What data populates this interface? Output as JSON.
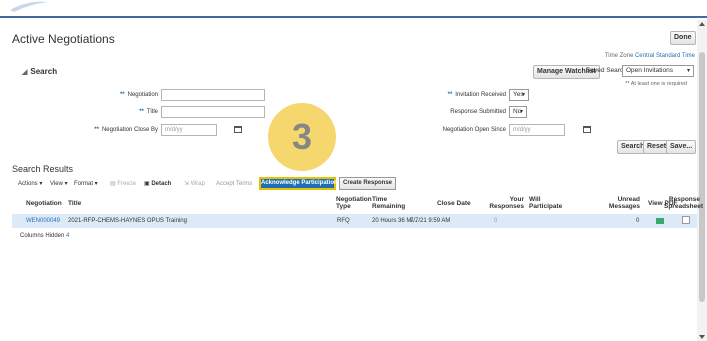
{
  "page": {
    "title": "Active Negotiations",
    "done_label": "Done",
    "time_zone_label": "Time Zone",
    "time_zone_value": "Central Standard Time"
  },
  "search": {
    "heading": "Search",
    "manage_watchlist_label": "Manage Watchlist",
    "saved_search_label": "Saved Search",
    "saved_search_value": "Open Invitations",
    "required_note": "** At least one is required",
    "fields": {
      "negotiation_label": "Negotiation",
      "title_label": "Title",
      "close_by_label": "Negotiation Close By",
      "close_by_placeholder": "m/d/yy",
      "invitation_received_label": "Invitation Received",
      "invitation_received_value": "Yes",
      "response_submitted_label": "Response Submitted",
      "response_submitted_value": "No",
      "open_since_label": "Negotiation Open Since",
      "open_since_placeholder": "m/d/yy"
    },
    "search_button": "Search",
    "reset_button": "Reset",
    "save_button": "Save..."
  },
  "overlay": {
    "step_number": "3"
  },
  "results": {
    "title": "Search Results",
    "toolbar": {
      "actions": "Actions",
      "view": "View",
      "format": "Format",
      "freeze": "Freeze",
      "detach": "Detach",
      "wrap": "Wrap",
      "accept_terms": "Accept Terms",
      "acknowledge": "Acknowledge Participation",
      "create_response": "Create Response"
    },
    "columns": {
      "negotiation": "Negotiation",
      "title": "Title",
      "negotiation_type": "Negotiation Type",
      "time_remaining": "Time Remaining",
      "close_date": "Close Date",
      "your_responses": "Your Responses",
      "will_participate": "Will Participate",
      "unread_messages": "Unread Messages",
      "view_pdf": "View PDF",
      "response_spreadsheet": "Response Spreadsheet"
    },
    "rows": [
      {
        "negotiation": "WEN000049",
        "title": "2021-RFP-CHEMS-HAYNES OPUS Training",
        "type": "RFQ",
        "time_remaining": "20 Hours 36 Mi...",
        "close_date": "7/7/21 9:59 AM",
        "your_responses": "0",
        "will_participate": "",
        "unread_messages": "0"
      }
    ],
    "columns_hidden_label": "Columns Hidden",
    "columns_hidden_count": "4"
  },
  "colors": {
    "accent": "#1f6fb5",
    "highlight": "#f4d35e",
    "row_selected": "#dceaf7"
  }
}
